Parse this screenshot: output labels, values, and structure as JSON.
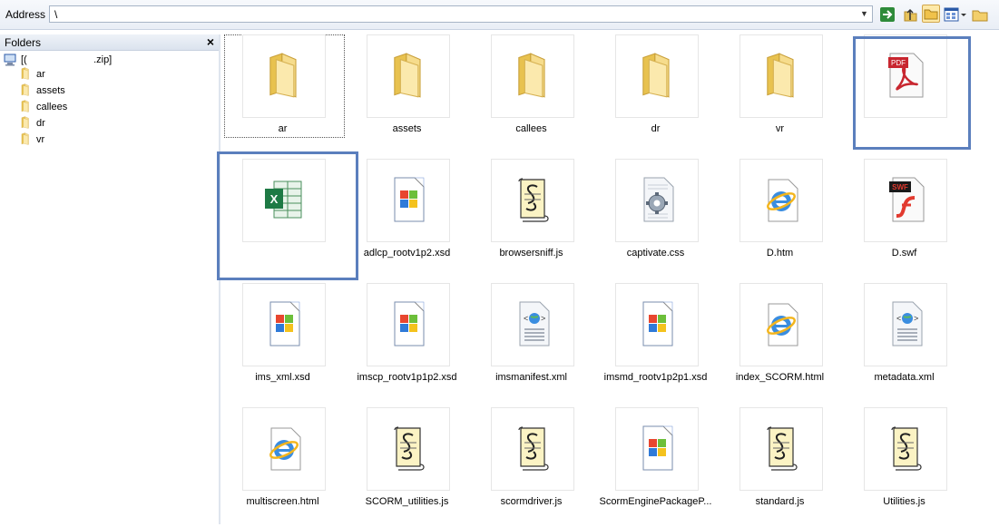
{
  "address": {
    "label": "Address",
    "value": "\\"
  },
  "toolbar": {
    "go_icon": "go-arrow-icon",
    "up_icon": "up-folder-icon",
    "folders_icon": "folders-toggle-icon",
    "views_icon": "views-icon",
    "newfolder_icon": "new-folder-icon"
  },
  "folders": {
    "title": "Folders",
    "close": "×",
    "root": "[(                        .zip]",
    "items": [
      "ar",
      "assets",
      "callees",
      "dr",
      "vr"
    ]
  },
  "files": [
    {
      "name": "ar",
      "icon": "folder-icon"
    },
    {
      "name": "assets",
      "icon": "folder-icon"
    },
    {
      "name": "callees",
      "icon": "folder-icon"
    },
    {
      "name": "dr",
      "icon": "folder-icon"
    },
    {
      "name": "vr",
      "icon": "folder-icon"
    },
    {
      "name": "",
      "icon": "pdf-icon",
      "badge": "PDF"
    },
    {
      "name": "",
      "icon": "excel-icon",
      "badge": "X"
    },
    {
      "name": "adlcp_rootv1p2.xsd",
      "icon": "windows-file-icon"
    },
    {
      "name": "browsersniff.js",
      "icon": "script-icon"
    },
    {
      "name": "captivate.css",
      "icon": "css-gear-icon"
    },
    {
      "name": "D.htm",
      "icon": "ie-icon"
    },
    {
      "name": "D.swf",
      "icon": "swf-icon",
      "badge": "SWF"
    },
    {
      "name": "ims_xml.xsd",
      "icon": "windows-file-icon"
    },
    {
      "name": "imscp_rootv1p1p2.xsd",
      "icon": "windows-file-icon"
    },
    {
      "name": "imsmanifest.xml",
      "icon": "xml-icon"
    },
    {
      "name": "imsmd_rootv1p2p1.xsd",
      "icon": "windows-file-icon"
    },
    {
      "name": "index_SCORM.html",
      "icon": "ie-icon"
    },
    {
      "name": "metadata.xml",
      "icon": "xml-icon"
    },
    {
      "name": "multiscreen.html",
      "icon": "ie-icon"
    },
    {
      "name": "SCORM_utilities.js",
      "icon": "script-icon"
    },
    {
      "name": "scormdriver.js",
      "icon": "script-icon"
    },
    {
      "name": "ScormEnginePackageP...",
      "icon": "windows-file-icon"
    },
    {
      "name": "standard.js",
      "icon": "script-icon"
    },
    {
      "name": "Utilities.js",
      "icon": "script-icon"
    }
  ]
}
